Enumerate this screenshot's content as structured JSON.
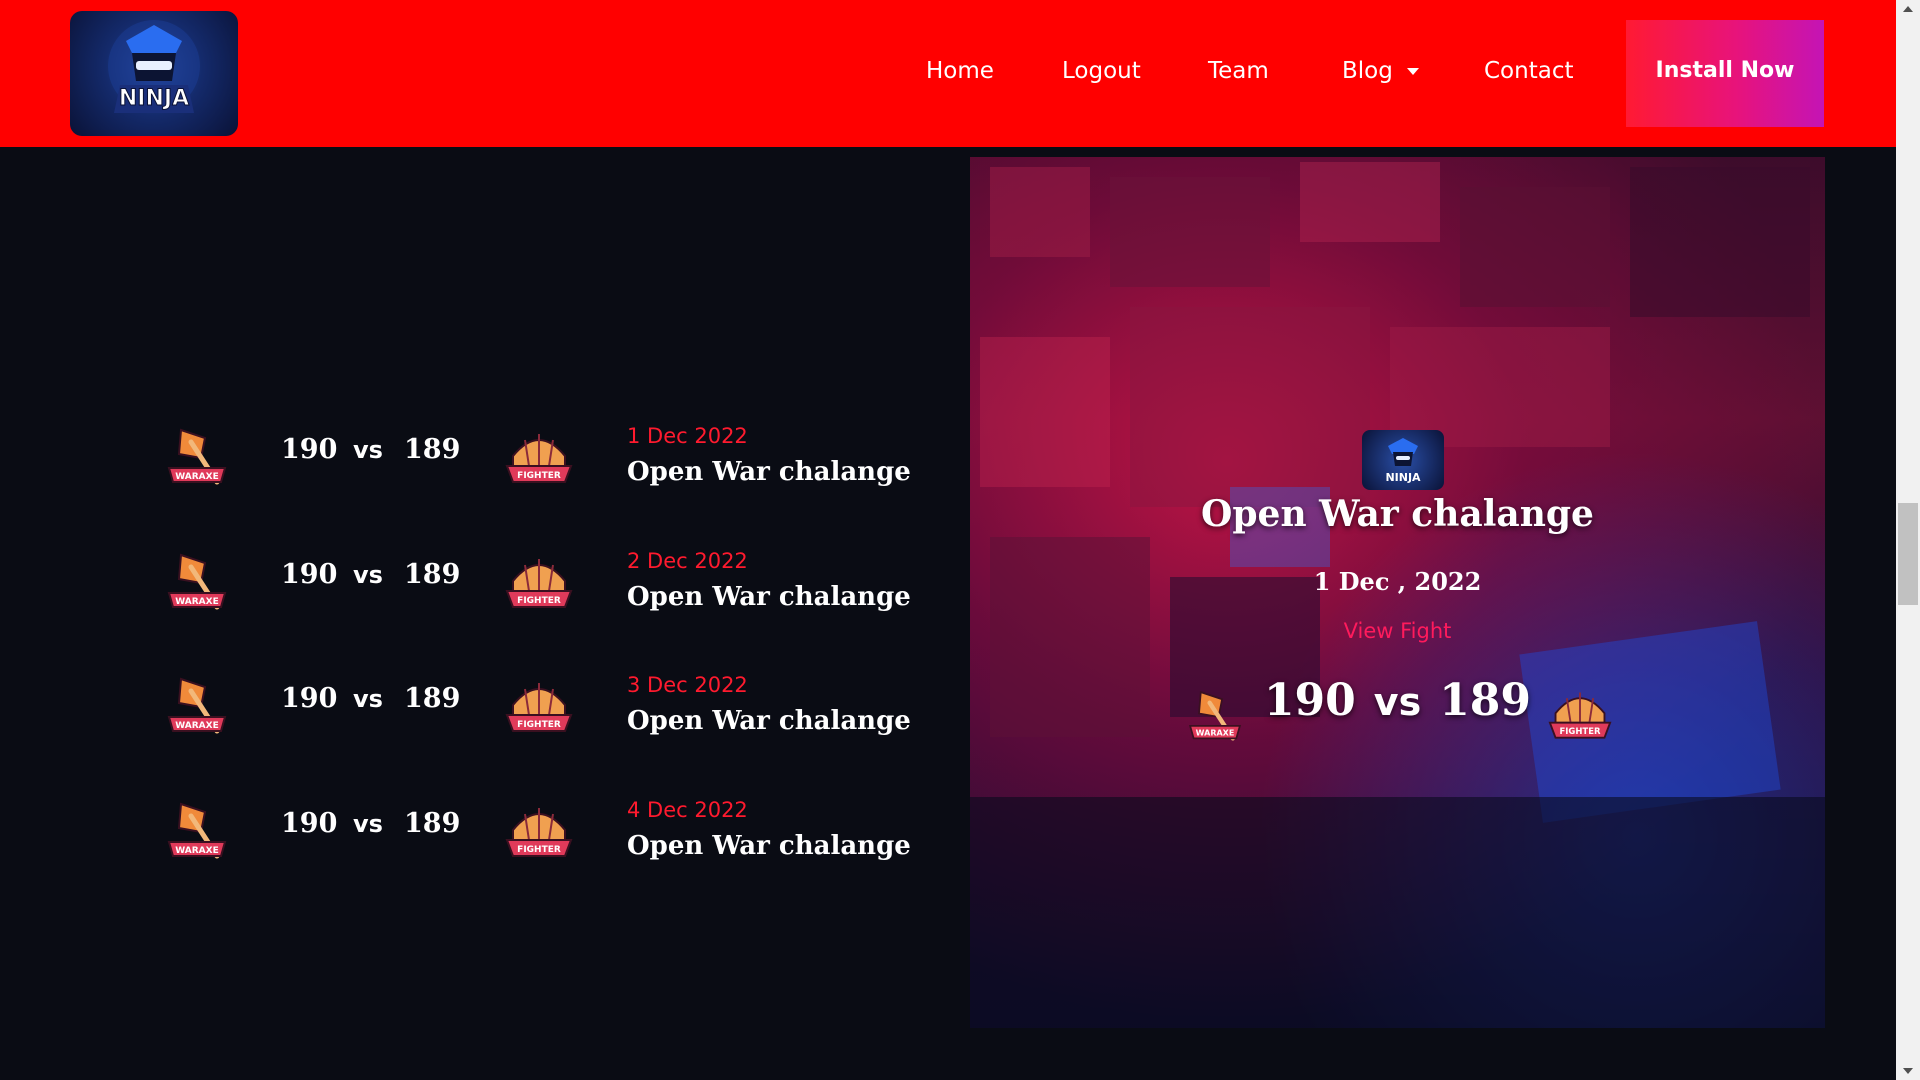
{
  "header": {
    "logo_text": "NINJA",
    "nav": {
      "home": "Home",
      "logout": "Logout",
      "team": "Team",
      "blog": "Blog",
      "contact": "Contact"
    },
    "install_label": "Install Now"
  },
  "badges": {
    "left_team": "WARAXE",
    "right_team": "FIGHTER"
  },
  "matches": [
    {
      "score_a": "190",
      "vs": "vs",
      "score_b": "189",
      "date": "1 Dec 2022",
      "title": "Open War chalange"
    },
    {
      "score_a": "190",
      "vs": "vs",
      "score_b": "189",
      "date": "2 Dec 2022",
      "title": "Open War chalange"
    },
    {
      "score_a": "190",
      "vs": "vs",
      "score_b": "189",
      "date": "3 Dec 2022",
      "title": "Open War chalange"
    },
    {
      "score_a": "190",
      "vs": "vs",
      "score_b": "189",
      "date": "4 Dec 2022",
      "title": "Open War chalange"
    }
  ],
  "featured": {
    "logo_text": "NINJA",
    "title": "Open War chalange",
    "date": "1 Dec , 2022",
    "link": "View Fight",
    "score_a": "190",
    "vs": "vs",
    "score_b": "189"
  },
  "colors": {
    "header_bg": "#ff0000",
    "page_bg": "#0a0c14",
    "accent_date": "#ff1a2e",
    "install_gradient_start": "#ff1a33",
    "install_gradient_end": "#c414b5"
  },
  "icons": {
    "logo": "ninja-mascot-icon",
    "left_badge": "axe-badge-icon",
    "right_badge": "helmet-badge-icon",
    "blog_caret": "caret-down-icon"
  }
}
